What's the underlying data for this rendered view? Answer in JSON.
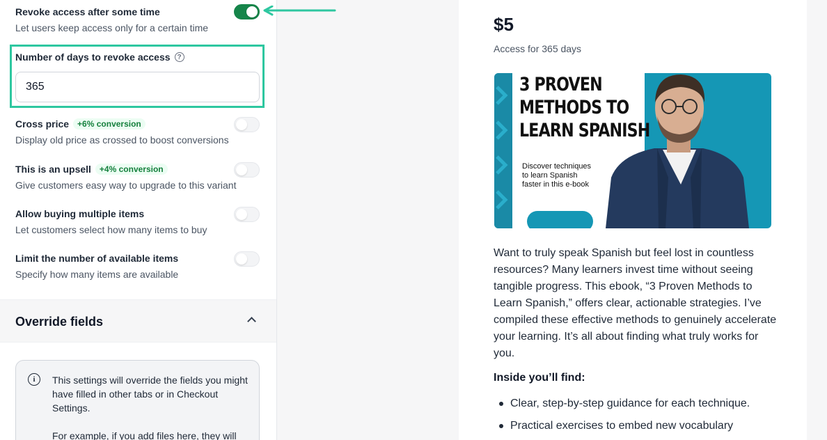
{
  "settings": {
    "revoke": {
      "title": "Revoke access after some time",
      "desc": "Let users keep access only for a certain time",
      "enabled": true
    },
    "days": {
      "label": "Number of days to revoke access",
      "help": "?",
      "value": "365"
    },
    "cross_price": {
      "title": "Cross price",
      "badge": "+6% conversion",
      "desc": "Display old price as crossed to boost conversions",
      "enabled": false
    },
    "upsell": {
      "title": "This is an upsell",
      "badge": "+4% conversion",
      "desc": "Give customers easy way to upgrade to this variant",
      "enabled": false
    },
    "multiple": {
      "title": "Allow buying multiple items",
      "desc": "Let customers select how many items to buy",
      "enabled": false
    },
    "limit": {
      "title": "Limit the number of available items",
      "desc": "Specify how many items are available",
      "enabled": false
    }
  },
  "override": {
    "title": "Override fields",
    "info_icon": "i",
    "info_text": "This settings will override the fields you might have filled in other tabs or in Checkout Settings.",
    "info_text2": "For example, if you add files here, they will"
  },
  "preview": {
    "price": "$5",
    "access": "Access for 365 days",
    "cover": {
      "title_lines": [
        "3 PROVEN",
        "METHODS TO",
        "LEARN SPANISH"
      ],
      "subtitle_lines": [
        "Discover techniques",
        "to learn Spanish",
        "faster in this e-book"
      ]
    },
    "description": "Want to truly speak Spanish but feel lost in countless resources? Many learners invest time without seeing tangible progress. This ebook, “3 Proven Methods to Learn Spanish,” offers clear, actionable strategies. I’ve compiled these effective methods to genuinely accelerate your learning. It’s all about finding what truly works for you.",
    "inside_heading": "Inside you’ll find:",
    "bullets": [
      "Clear, step-by-step guidance for each technique.",
      "Practical exercises to embed new vocabulary"
    ]
  },
  "colors": {
    "accent_green": "#16854a",
    "highlight": "#2ec7a0",
    "cover_teal": "#1597b5"
  }
}
